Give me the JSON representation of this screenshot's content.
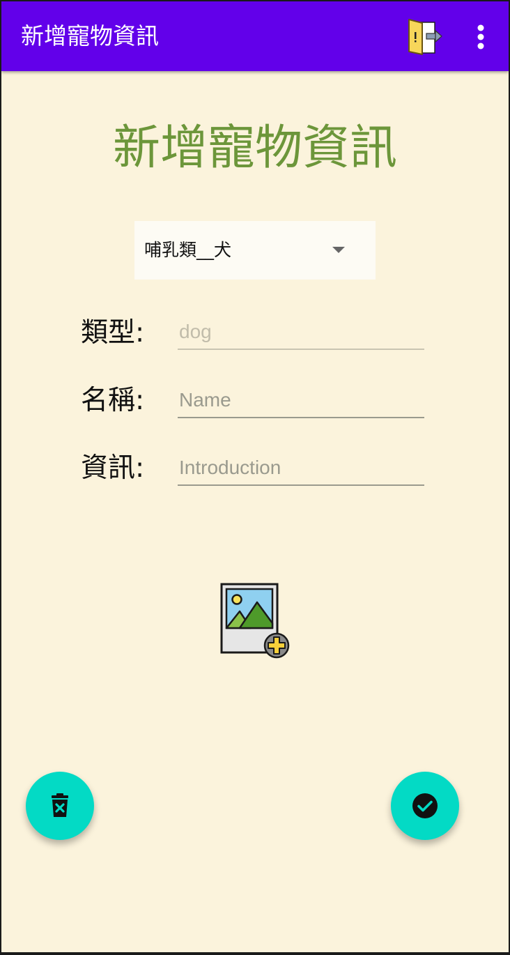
{
  "appbar": {
    "title": "新增寵物資訊",
    "background_color": "#6200EA",
    "actions": [
      {
        "name": "exit-door-icon"
      },
      {
        "name": "overflow-menu-icon"
      }
    ]
  },
  "page": {
    "background_color": "#FBF3DC",
    "title": "新增寵物資訊",
    "title_color": "#6C963A"
  },
  "spinner": {
    "selected": "哺乳類__犬",
    "icon": "dropdown-arrow-icon"
  },
  "form": {
    "type_label": "類型:",
    "type_placeholder": "dog",
    "name_label": "名稱:",
    "name_placeholder": "Name",
    "info_label": "資訊:",
    "info_placeholder": "Introduction"
  },
  "image_picker": {
    "icon": "add-image-icon"
  },
  "fabs": {
    "color": "#03DAC5",
    "delete_icon": "delete-forever-icon",
    "confirm_icon": "check-circle-icon"
  }
}
